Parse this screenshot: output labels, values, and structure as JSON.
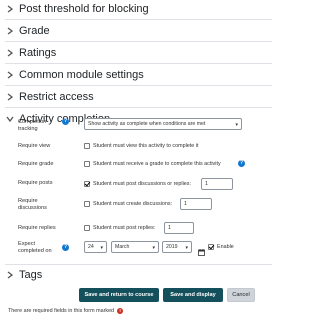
{
  "sections": [
    {
      "title": "Post threshold for blocking",
      "expanded": false
    },
    {
      "title": "Grade",
      "expanded": false
    },
    {
      "title": "Ratings",
      "expanded": false
    },
    {
      "title": "Common module settings",
      "expanded": false
    },
    {
      "title": "Restrict access",
      "expanded": false
    },
    {
      "title": "Activity completion",
      "expanded": true
    },
    {
      "title": "Tags",
      "expanded": false
    }
  ],
  "completion": {
    "tracking_label": "Completion tracking",
    "tracking_value": "Show activity as complete when conditions are met",
    "view_label": "Require view",
    "view_text": "Student must view this activity to complete it",
    "grade_label": "Require grade",
    "grade_text": "Student must receive a grade to complete this activity",
    "posts_label": "Require posts",
    "posts_text": "Student must post discussions or replies:",
    "posts_value": "1",
    "discussions_label": "Require discussions",
    "discussions_text": "Student must create discussions:",
    "discussions_value": "1",
    "replies_label": "Require replies",
    "replies_text": "Student must post replies:",
    "replies_value": "1",
    "expect_label": "Expect completed on",
    "expect_day": "24",
    "expect_month": "March",
    "expect_year": "2019",
    "enable_text": "Enable"
  },
  "checked": {
    "view": false,
    "grade": false,
    "posts": true,
    "discussions": false,
    "replies": false,
    "enable": true
  },
  "buttons": {
    "save_return": "Save and return to course",
    "save_display": "Save and display",
    "cancel": "Cancel"
  },
  "required_note": "There are required fields in this form marked",
  "icons": {
    "help": "question-circle-icon",
    "calendar": "calendar-icon",
    "chevron_right": "chevron-right-icon",
    "chevron_down": "chevron-down-icon",
    "required": "exclamation-circle-icon"
  },
  "colors": {
    "accent": "#1177d1",
    "primary_button": "#14505c",
    "required": "#ca3120"
  }
}
